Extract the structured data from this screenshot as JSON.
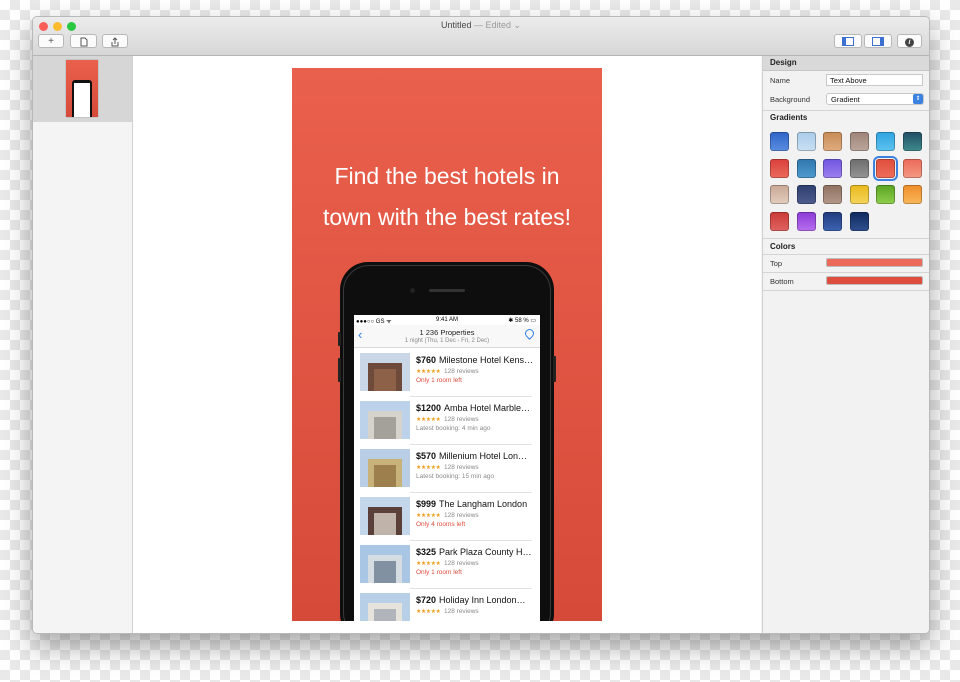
{
  "window": {
    "title": "Untitled",
    "edited": "— Edited ⌄"
  },
  "toolbar": {
    "add_label": "+",
    "info_label": "i"
  },
  "icons": [
    "add-icon",
    "new-document-icon",
    "share-icon",
    "left-sidebar-icon",
    "right-sidebar-icon",
    "info-icon"
  ],
  "artboard": {
    "headline_line1": "Find the best hotels in",
    "headline_line2": "town with the best rates!",
    "gradient_top": "#e9604c",
    "gradient_bottom": "#d64a39"
  },
  "phone": {
    "status": {
      "carrier": "●●●○○ GS ᯤ",
      "time": "9:41 AM",
      "battery": "✱ 58 % ▭"
    },
    "nav": {
      "back": "‹",
      "title": "1 236 Properties",
      "subtitle": "1 night (Thu, 1 Dec - Fri, 2 Dec)"
    },
    "hotels": [
      {
        "price": "$760",
        "name": "Milestone Hotel Kens…",
        "stars": "★★★★★",
        "reviews": "128 reviews",
        "note": "Only 1 room left",
        "note_color": "#e04b3a"
      },
      {
        "price": "$1200",
        "name": "Amba Hotel Marble…",
        "stars": "★★★★★",
        "reviews": "128 reviews",
        "note": "Latest booking: 4 min ago",
        "note_color": "#8a8a8a"
      },
      {
        "price": "$570",
        "name": "Millenium Hotel Lon…",
        "stars": "★★★★★",
        "reviews": "128 reviews",
        "note": "Latest booking: 15 min ago",
        "note_color": "#8a8a8a"
      },
      {
        "price": "$999",
        "name": "The Langham London",
        "stars": "★★★★★",
        "reviews": "128 reviews",
        "note": "Only 4 rooms left",
        "note_color": "#e04b3a"
      },
      {
        "price": "$325",
        "name": "Park Plaza County H…",
        "stars": "★★★★★",
        "reviews": "128 reviews",
        "note": "Only 1 room left",
        "note_color": "#e04b3a"
      },
      {
        "price": "$720",
        "name": "Holiday Inn London…",
        "stars": "★★★★★",
        "reviews": "128 reviews",
        "note": "",
        "note_color": "#8a8a8a"
      }
    ]
  },
  "inspector": {
    "design_header": "Design",
    "name_label": "Name",
    "name_value": "Text Above",
    "background_label": "Background",
    "background_value": "Gradient",
    "gradients_header": "Gradients",
    "gradients": [
      [
        "#2f64c7",
        "#5a8ee0"
      ],
      [
        "#a9cbe9",
        "#c9e0f3"
      ],
      [
        "#c88b55",
        "#e0ad80"
      ],
      [
        "#9e8377",
        "#bba79d"
      ],
      [
        "#2fa3e0",
        "#5ec3f0"
      ],
      [
        "#224d66",
        "#3f8b8d"
      ],
      [
        "#d8403a",
        "#ec6b5c"
      ],
      [
        "#2f77ad",
        "#4f9bcf"
      ],
      [
        "#6f55e0",
        "#9e7ff0"
      ],
      [
        "#6c6c6c",
        "#959595"
      ],
      [
        "#e04e3c",
        "#ee6e5b"
      ],
      [
        "#ec6a5a",
        "#f49a84"
      ],
      [
        "#c9a894",
        "#e2ccbf"
      ],
      [
        "#2e3e6e",
        "#4d5c8d"
      ],
      [
        "#8e7161",
        "#b39889"
      ],
      [
        "#e9b81e",
        "#f4d55a"
      ],
      [
        "#5aa322",
        "#8fcf4d"
      ],
      [
        "#f08c2a",
        "#f7b85a"
      ],
      [
        "#c93a37",
        "#e06461"
      ],
      [
        "#8a3ad6",
        "#b86ff0"
      ],
      [
        "#1f3b7e",
        "#3d63b2"
      ],
      [
        "#0e2a5e",
        "#2f4e8e"
      ]
    ],
    "selected_gradient": 10,
    "colors_header": "Colors",
    "top_label": "Top",
    "bottom_label": "Bottom",
    "top_color": "#ec6a5a",
    "bottom_color": "#de4e3e"
  }
}
